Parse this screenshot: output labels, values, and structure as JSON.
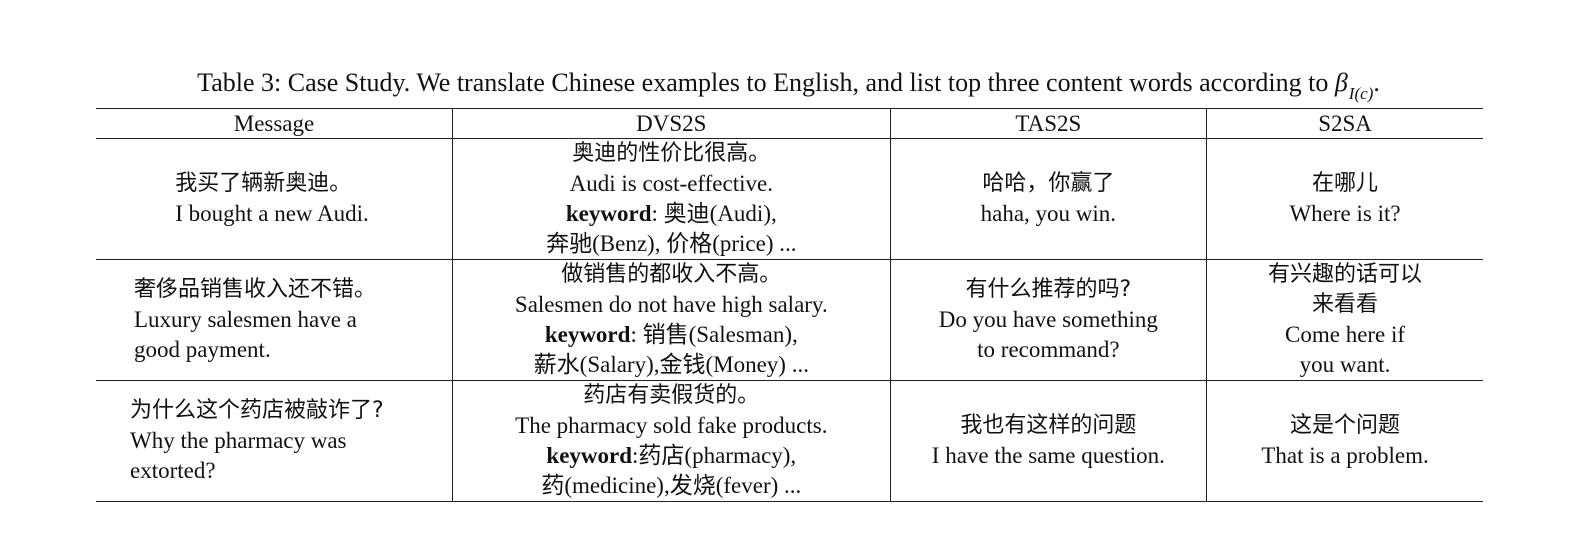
{
  "caption": {
    "prefix": "Table 3: Case Study. We translate Chinese examples to English, and list top three content words according to ",
    "symbol": "β",
    "subscript": "I(c)",
    "suffix": "."
  },
  "headers": [
    "Message",
    "DVS2S",
    "TAS2S",
    "S2SA"
  ],
  "rows": [
    {
      "message": {
        "cn": "我买了辆新奥迪。",
        "en_lines": [
          "I bought a new Audi."
        ]
      },
      "dvs2s": {
        "cn": "奥迪的性价比很高。",
        "en": "Audi is cost-effective.",
        "keyword_label": "keyword",
        "keyword_line1": ": 奥迪(Audi),",
        "keyword_line2": "奔驰(Benz), 价格(price) ..."
      },
      "tas2s": {
        "cn": "哈哈，你赢了",
        "en_lines": [
          "haha, you win."
        ]
      },
      "s2sa": {
        "cn_lines": [
          "在哪儿"
        ],
        "en_lines": [
          "Where is it?"
        ]
      }
    },
    {
      "message": {
        "cn": "奢侈品销售收入还不错。",
        "en_lines": [
          "Luxury salesmen have a",
          "good payment."
        ]
      },
      "dvs2s": {
        "cn": "做销售的都收入不高。",
        "en": "Salesmen do not have high salary.",
        "keyword_label": "keyword",
        "keyword_line1": ": 销售(Salesman),",
        "keyword_line2": "薪水(Salary),金钱(Money) ..."
      },
      "tas2s": {
        "cn": "有什么推荐的吗?",
        "en_lines": [
          "Do you have something",
          "to recommand?"
        ]
      },
      "s2sa": {
        "cn_lines": [
          "有兴趣的话可以",
          "来看看"
        ],
        "en_lines": [
          "Come here if",
          "you want."
        ]
      }
    },
    {
      "message": {
        "cn": "为什么这个药店被敲诈了?",
        "en_lines": [
          "Why the pharmacy was",
          "extorted?"
        ]
      },
      "dvs2s": {
        "cn": "药店有卖假货的。",
        "en": "The pharmacy sold fake products.",
        "keyword_label": "keyword",
        "keyword_line1": ":药店(pharmacy),",
        "keyword_line2": "药(medicine),发烧(fever) ..."
      },
      "tas2s": {
        "cn": "我也有这样的问题",
        "en_lines": [
          "I have the same question."
        ]
      },
      "s2sa": {
        "cn_lines": [
          "这是个问题"
        ],
        "en_lines": [
          "That is a problem."
        ]
      }
    }
  ]
}
